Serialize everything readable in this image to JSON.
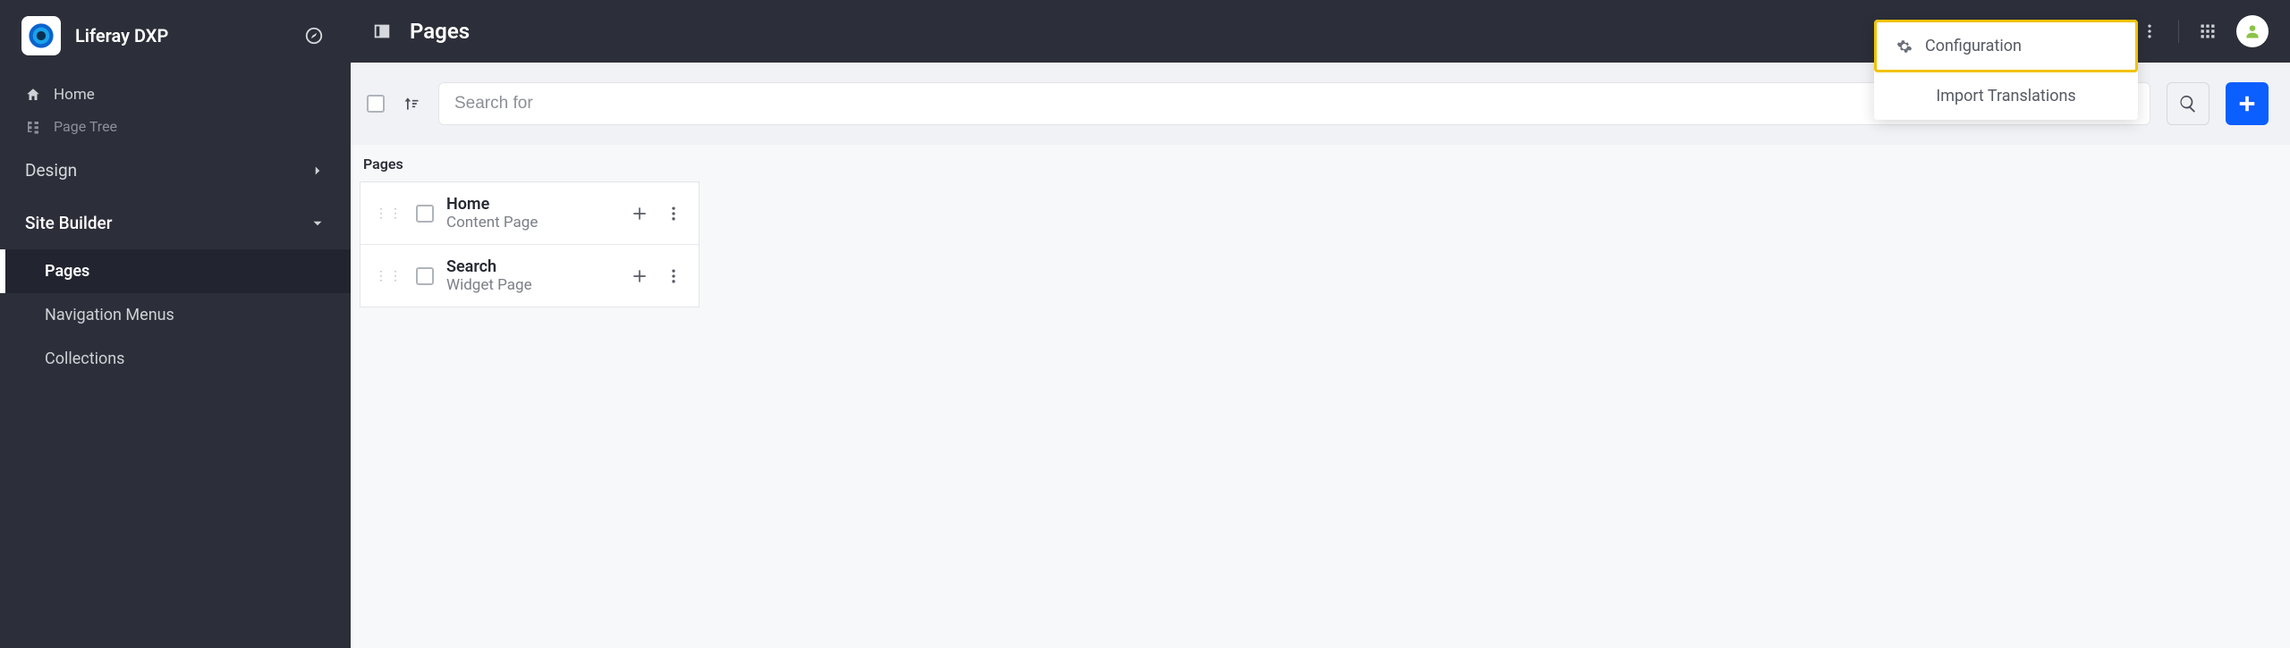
{
  "brand": {
    "title": "Liferay DXP"
  },
  "sidebar": {
    "home": "Home",
    "pageTree": "Page Tree",
    "sections": {
      "design": "Design",
      "siteBuilder": "Site Builder"
    },
    "siteBuilderItems": [
      {
        "label": "Pages"
      },
      {
        "label": "Navigation Menus"
      },
      {
        "label": "Collections"
      }
    ]
  },
  "header": {
    "title": "Pages"
  },
  "dropdown": {
    "configuration": "Configuration",
    "importTranslations": "Import Translations"
  },
  "toolbar": {
    "searchPlaceholder": "Search for"
  },
  "content": {
    "sectionLabel": "Pages",
    "rows": [
      {
        "title": "Home",
        "subtitle": "Content Page"
      },
      {
        "title": "Search",
        "subtitle": "Widget Page"
      }
    ]
  }
}
